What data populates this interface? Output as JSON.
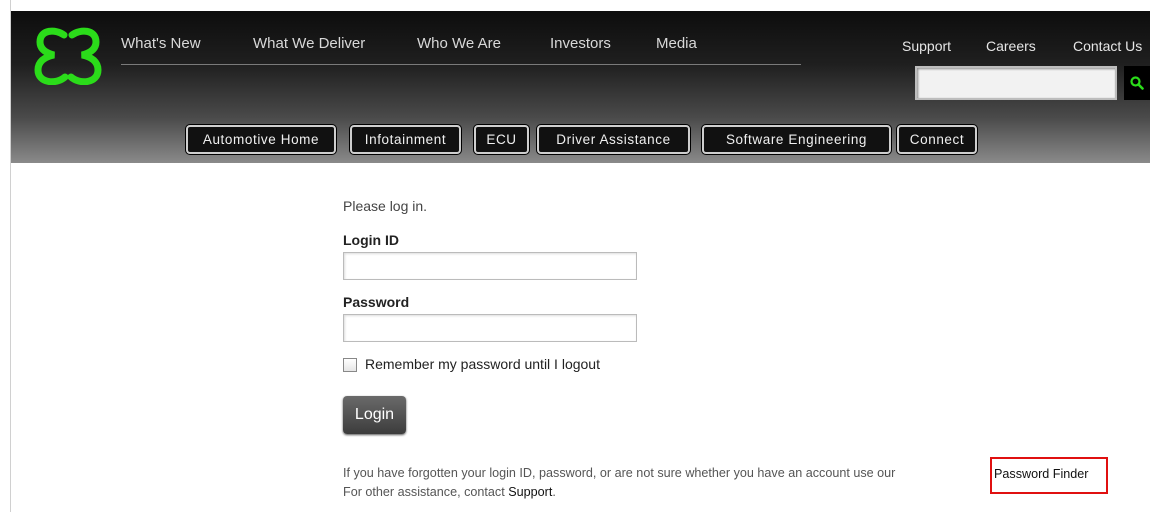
{
  "header": {
    "brand_color": "#2bdc1a",
    "main_nav": [
      "What's New",
      "What We Deliver",
      "Who We Are",
      "Investors",
      "Media"
    ],
    "utility_nav": [
      "Support",
      "Careers",
      "Contact Us"
    ],
    "search": {
      "placeholder": "",
      "button_icon": "search-icon"
    },
    "sub_nav": [
      "Automotive Home",
      "Infotainment",
      "ECU",
      "Driver Assistance",
      "Software Engineering",
      "Connect"
    ]
  },
  "login": {
    "intro": "Please log in.",
    "login_id_label": "Login ID",
    "login_id_value": "",
    "password_label": "Password",
    "password_value": "",
    "remember_label": "Remember my password until I logout",
    "remember_checked": false,
    "login_button": "Login",
    "help_text": "If you have forgotten your login ID, password, or are not sure whether you have an account use our",
    "password_finder_link": "Password Finder",
    "other_help_prefix": "For other assistance, contact",
    "support_link": "Support",
    "other_help_suffix": "."
  }
}
